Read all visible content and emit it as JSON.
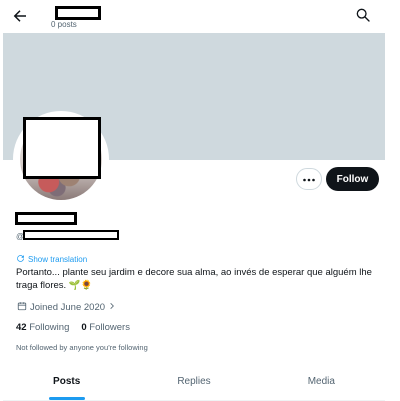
{
  "header": {
    "post_count": "0 posts",
    "back_icon": "arrow-left-icon",
    "search_icon": "search-icon"
  },
  "profile": {
    "handle_prefix": "@",
    "show_translation": "Show translation",
    "bio": "Portanto... plante seu jardim e decore sua alma, ao invés de esperar que alguém lhe traga flores. 🌱🌻",
    "joined": "Joined June 2020",
    "following_count": "42",
    "following_label": "Following",
    "followers_count": "0",
    "followers_label": "Followers",
    "not_followed": "Not followed by anyone you’re following"
  },
  "actions": {
    "follow_label": "Follow",
    "more_icon": "more-icon"
  },
  "tabs": [
    {
      "label": "Posts",
      "active": true
    },
    {
      "label": "Replies",
      "active": false
    },
    {
      "label": "Media",
      "active": false
    }
  ],
  "colors": {
    "accent": "#1d9bf0",
    "banner": "#cfd9de",
    "follow_bg": "#0f1419",
    "muted_text": "#536471"
  }
}
